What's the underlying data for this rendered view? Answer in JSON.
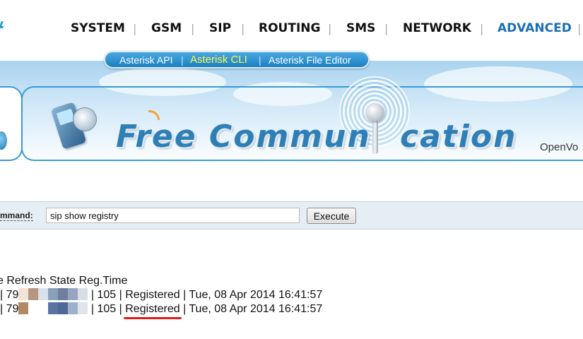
{
  "nav": {
    "items": [
      {
        "label": "SYSTEM"
      },
      {
        "label": "GSM"
      },
      {
        "label": "SIP"
      },
      {
        "label": "ROUTING"
      },
      {
        "label": "SMS"
      },
      {
        "label": "NETWORK"
      },
      {
        "label": "ADVANCED"
      }
    ],
    "separator": "|",
    "active": "ADVANCED",
    "active_color": "#1b6fb5"
  },
  "submenu": {
    "items": [
      {
        "label": "Asterisk API"
      },
      {
        "label": "Asterisk CLI"
      },
      {
        "label": "Asterisk File Editor"
      }
    ],
    "separator": "|",
    "active": "Asterisk CLI",
    "active_color": "#fff94a"
  },
  "banner": {
    "brand_part_a": "Free Commun",
    "brand_part_b": "cation",
    "side_text": "OpenVo"
  },
  "command_bar": {
    "label": "mmand:",
    "input_value": "sip show registry",
    "execute_label": "Execute"
  },
  "output": {
    "header": "e Refresh State Reg.Time",
    "rows": [
      {
        "prefix": " | 79",
        "refresh": "105",
        "state": "Registered",
        "reg_time": "Tue, 08 Apr 2014 16:41:57"
      },
      {
        "prefix": " | 79",
        "refresh": "105",
        "state": "Registered",
        "reg_time": "Tue, 08 Apr 2014 16:41:57"
      }
    ],
    "highlight_color": "#e01b1b"
  }
}
